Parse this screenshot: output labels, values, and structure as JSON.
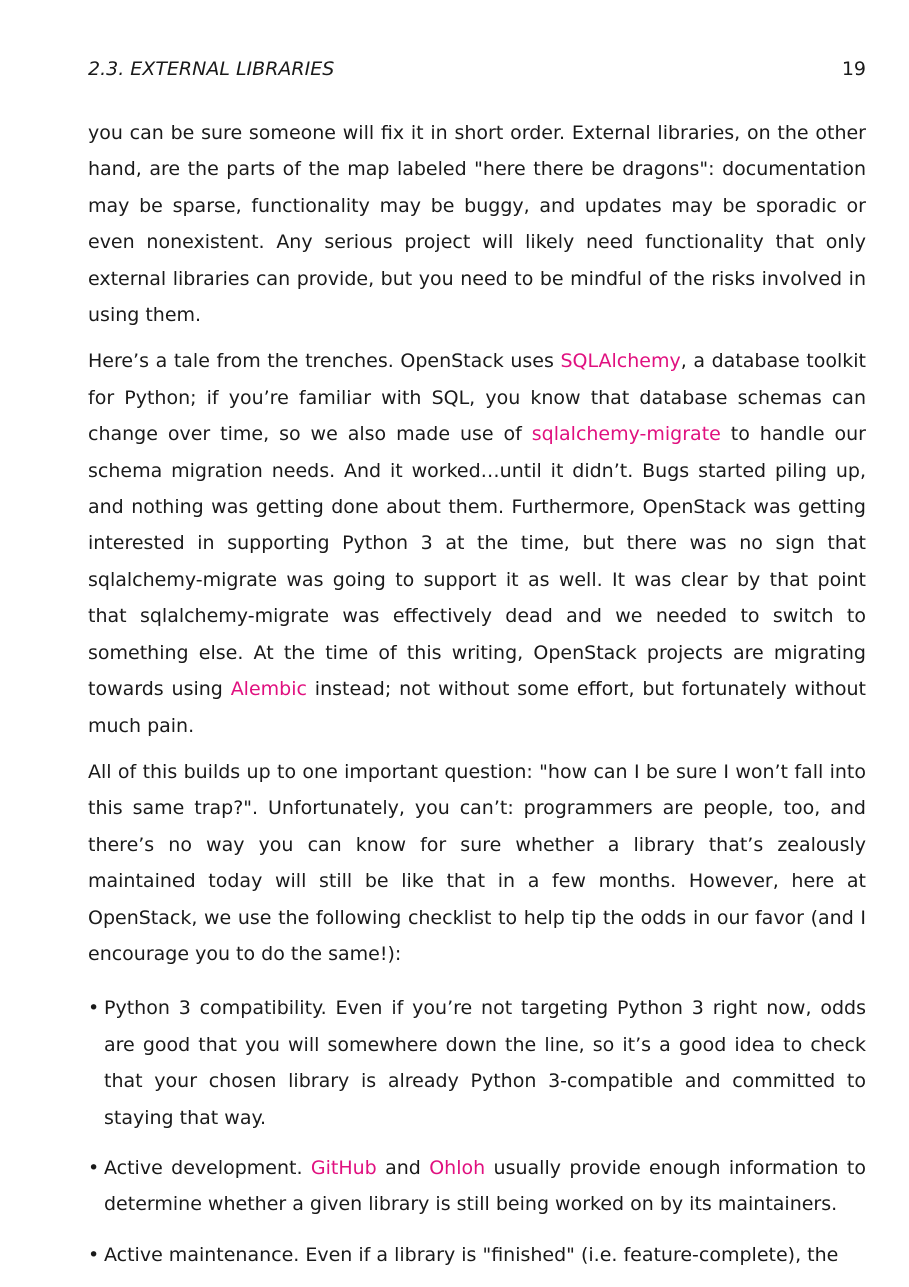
{
  "header": {
    "section": "2.3.  EXTERNAL LIBRARIES",
    "page_number": "19"
  },
  "paragraphs": {
    "p1": "you can be sure someone will fix it in short order.  External libraries, on the other hand, are the parts of the map labeled \"here there be dragons\":  documentation may be sparse, functionality may be buggy, and updates may be sporadic or even nonexistent.  Any serious project will likely need functionality that only external libraries can provide, but you need to be mindful of the risks involved in using them.",
    "p2": {
      "t1": "Here’s a tale from the trenches. OpenStack uses ",
      "link_sqlalchemy": "SQLAlchemy",
      "t2": ", a database toolkit for Python; if you’re familiar with SQL, you know that database schemas can change over time, so we also made use of ",
      "link_migrate": "sqlalchemy-migrate",
      "t3": " to handle our schema migration needs. And it worked…until it didn’t. Bugs started piling up, and nothing was getting done about them.  Furthermore, OpenStack was getting interested in supporting Python 3 at the time, but there was no sign that sqlalchemy-migrate was going to support it as well.  It was clear by that point that sqlalchemy-migrate was effectively dead and we needed to switch to something else. At the time of this writing, OpenStack projects are migrating towards using ",
      "link_alembic": "Alembic",
      "t4": " instead; not without some effort, but fortunately without much pain."
    },
    "p3": "All of this builds up to one important question:  \"how can I be sure I won’t fall into this same trap?\". Unfortunately, you can’t: programmers are people, too, and there’s no way you can know for sure whether a library that’s zealously maintained today will still be like that in a few months.  However, here at OpenStack, we use the following checklist to help tip the odds in our favor (and I encourage you to do the same!):"
  },
  "checklist": {
    "bullet": "•",
    "item1": "Python 3 compatibility.  Even if you’re not targeting Python 3 right now, odds are good that you will somewhere down the line, so it’s a good idea to check that your chosen library is already Python 3-compatible and committed to staying that way.",
    "item2": {
      "t1": "Active development.  ",
      "link_github": "GitHub",
      "t2": " and ",
      "link_ohloh": "Ohloh",
      "t3": " usually provide enough information to determine whether a given library is still being worked on by its maintainers."
    },
    "item3": "Active maintenance.  Even if a library is \"finished\" (i.e.  feature-complete), the"
  },
  "colors": {
    "link": "#e0107f",
    "text": "#1a1a1a"
  }
}
